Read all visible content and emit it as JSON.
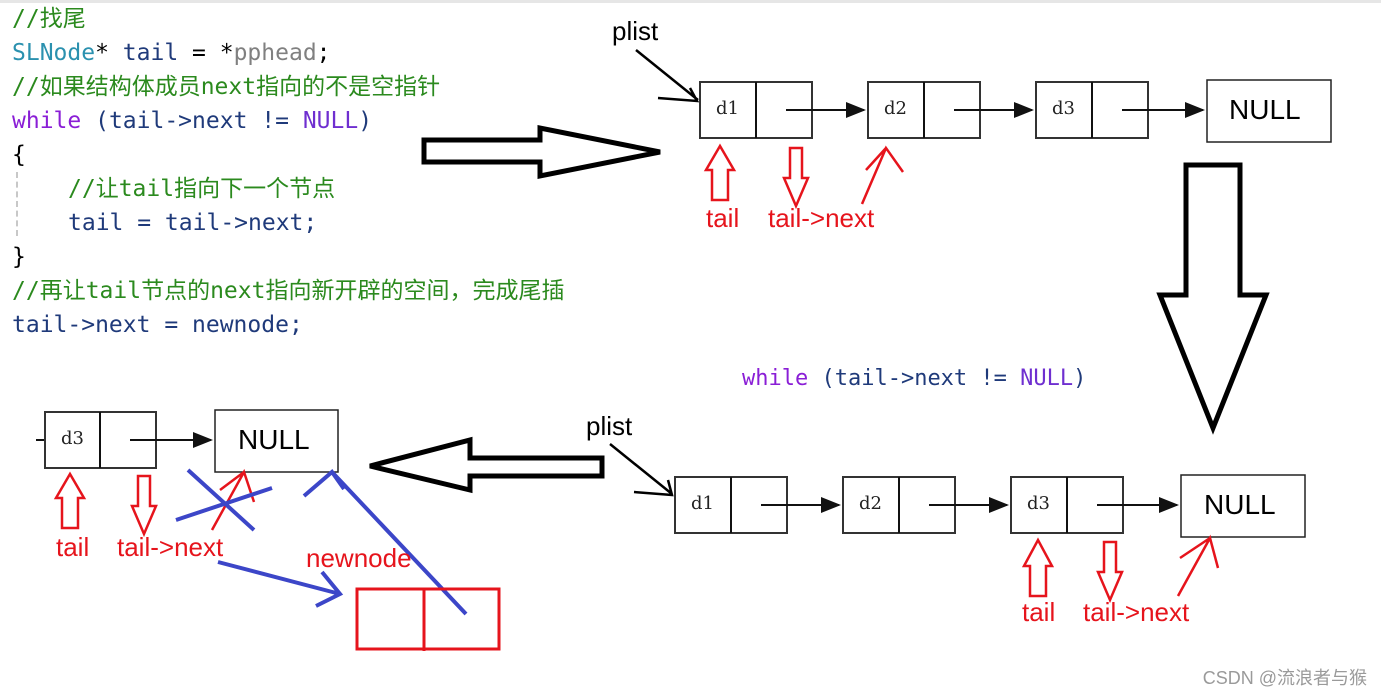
{
  "code_block": {
    "lines": [
      {
        "comment": "//找尾"
      },
      {
        "type": "SLNode",
        "star": "* ",
        "ident": "tail",
        "op": " = *",
        "param": "pphead",
        "end": ";"
      },
      {
        "comment": "//如果结构体成员next指向的不是空指针"
      },
      {
        "keyword": "while",
        "rest1": " (tail->next != ",
        "macro": "NULL",
        "rest2": ")"
      },
      {
        "text": "{"
      },
      {
        "comment": "//让tail指向下一个节点",
        "indent": true
      },
      {
        "ident": "tail = tail->next;",
        "indent": true
      },
      {
        "text": "}"
      },
      {
        "comment": "//再让tail节点的next指向新开辟的空间，完成尾插"
      },
      {
        "ident": "tail->next = newnode;"
      }
    ]
  },
  "snippet": {
    "keyword": "while",
    "rest1": " (tail->next != ",
    "macro": "NULL",
    "rest2": ")"
  },
  "diagram_top": {
    "head_label": "plist",
    "nodes": [
      "d1",
      "d2",
      "d3"
    ],
    "terminal": "NULL",
    "pointer_labels": {
      "tail": "tail",
      "tail_next": "tail->next"
    }
  },
  "diagram_mid": {
    "head_label": "plist",
    "nodes": [
      "d1",
      "d2",
      "d3"
    ],
    "terminal": "NULL",
    "pointer_labels": {
      "tail": "tail",
      "tail_next": "tail->next"
    }
  },
  "diagram_bottom": {
    "nodes": [
      "d3"
    ],
    "terminal": "NULL",
    "new_node_label": "newnode",
    "pointer_labels": {
      "tail": "tail",
      "tail_next": "tail->next"
    }
  },
  "colors": {
    "annotation_red": "#e6141c",
    "annotation_blue": "#3c46c8",
    "comment_green": "#2b8a1e",
    "keyword_purple": "#8a1ed6"
  },
  "watermark": "CSDN @流浪者与猴"
}
